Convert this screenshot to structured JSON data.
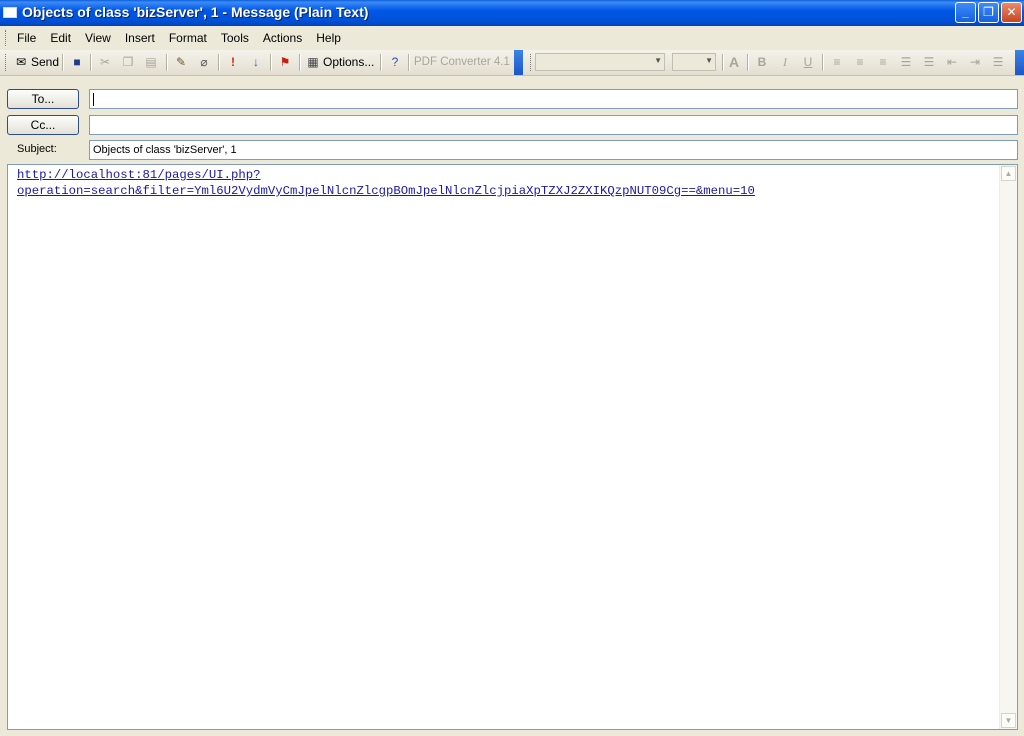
{
  "window": {
    "title": "Objects of class 'bizServer', 1 - Message (Plain Text)",
    "minimize": "_",
    "maximize": "❐",
    "close": "✕"
  },
  "menu": [
    "File",
    "Edit",
    "View",
    "Insert",
    "Format",
    "Tools",
    "Actions",
    "Help"
  ],
  "toolbar": {
    "send_label": "Send",
    "options_label": "Options...",
    "pdf_label": "PDF Converter 4.1",
    "font_name": "",
    "font_size": ""
  },
  "header": {
    "to_label": "To...",
    "cc_label": "Cc...",
    "subject_label": "Subject:",
    "to_value": "",
    "cc_value": "",
    "subject_value": "Objects of class 'bizServer', 1"
  },
  "body": {
    "line1": "http://localhost:81/pages/UI.php?",
    "line2": "operation=search&filter=Yml6U2VydmVyCmJpelNlcnZlcgpBOmJpelNlcnZlcjpiaXpTZXJ2ZXIKQzpNUT09Cg==&menu=10"
  },
  "colors": {
    "titlebar": "#0054e3",
    "link": "#1a1aa8",
    "chrome": "#ece9d8"
  }
}
